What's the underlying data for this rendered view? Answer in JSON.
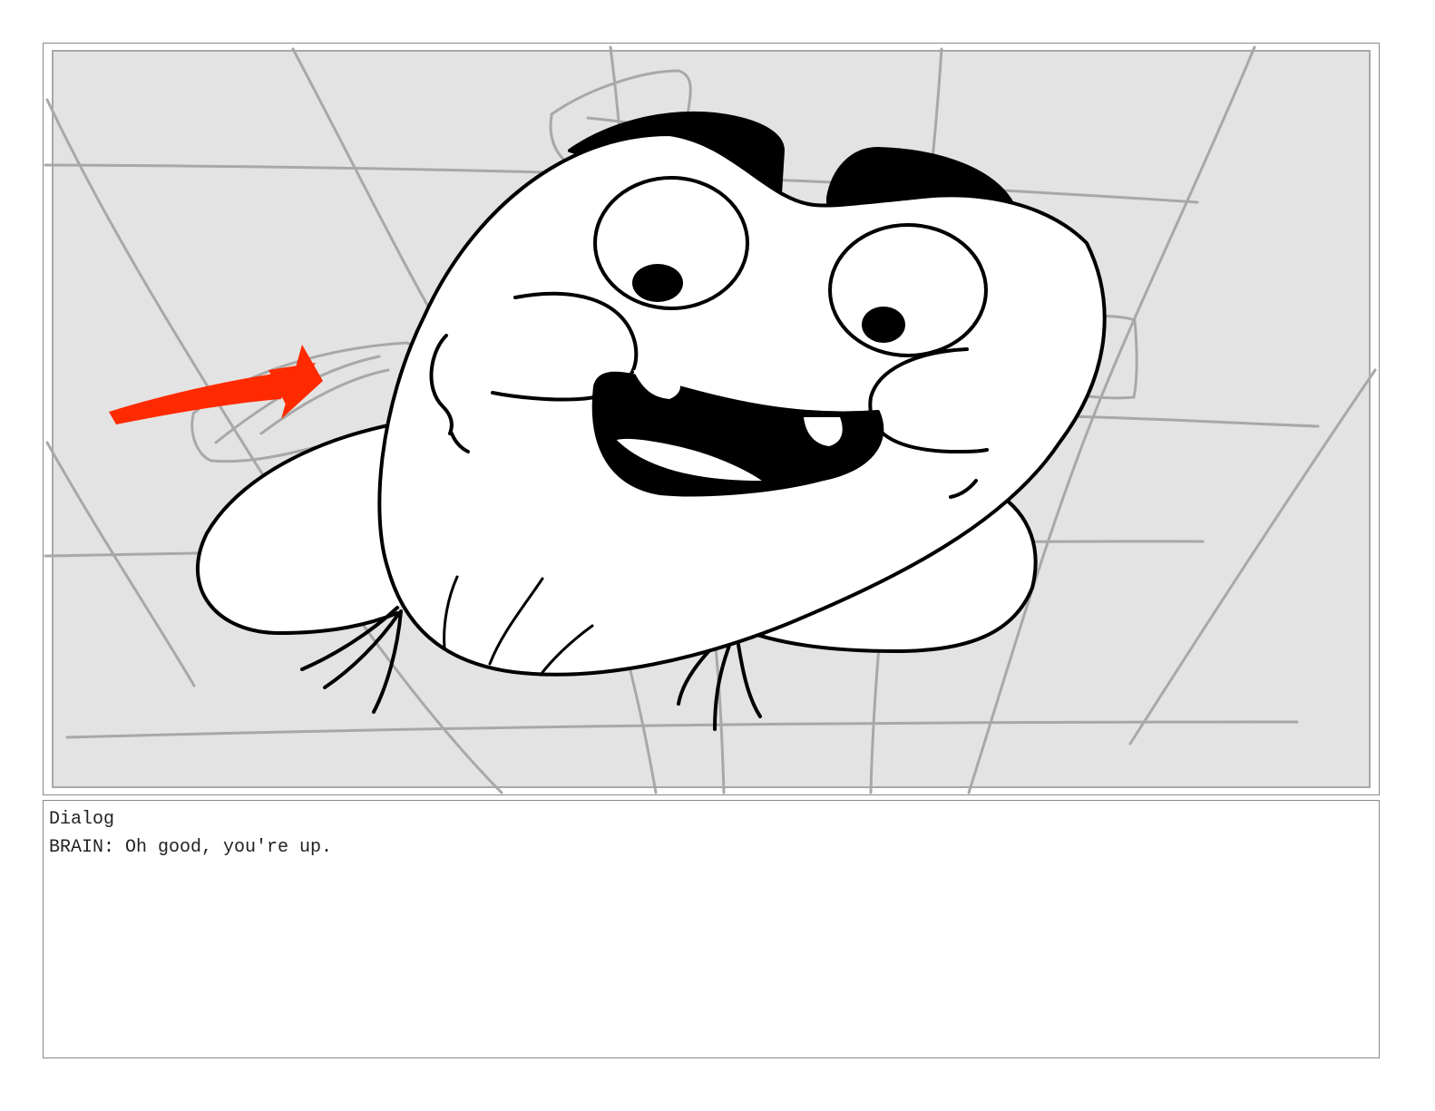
{
  "panel": {
    "illustration": "cartoon-brain-character",
    "colors": {
      "background": "#e3e3e3",
      "sketch_lines": "#a8a8a8",
      "ink": "#000000",
      "arrow": "#ff2a00"
    }
  },
  "dialog": {
    "heading": "Dialog",
    "line": "BRAIN: Oh good, you're up."
  }
}
